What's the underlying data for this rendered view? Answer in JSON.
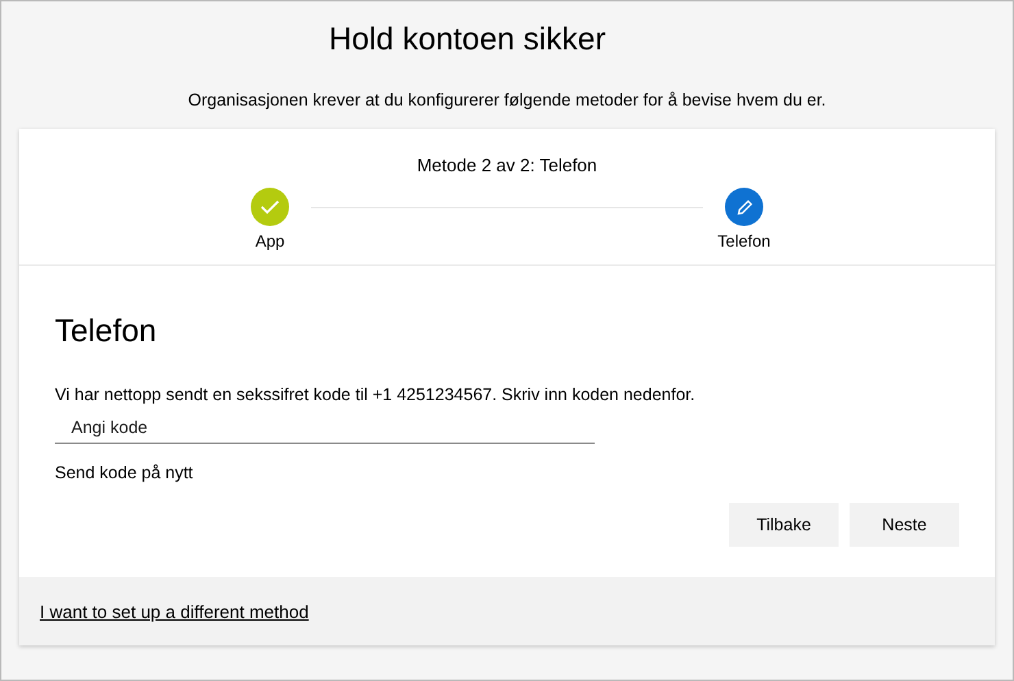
{
  "page": {
    "title": "Hold kontoen sikker",
    "subtitle": "Organisasjonen krever at du konfigurerer følgende metoder for å bevise hvem du er."
  },
  "progress": {
    "heading": "Metode 2 av 2: Telefon",
    "steps": [
      {
        "label": "App",
        "completed": true
      },
      {
        "label": "Telefon",
        "completed": false
      }
    ]
  },
  "section": {
    "title": "Telefon",
    "instruction": "Vi har nettopp sendt en sekssifret kode til +1 4251234567. Skriv inn koden nedenfor.",
    "code_field": {
      "placeholder": "Angi kode"
    },
    "resend_link": "Send kode på nytt"
  },
  "buttons": [
    {
      "label": "Tilbake"
    },
    {
      "label": "Neste"
    }
  ],
  "footer": {
    "link": "I want to set up a different method"
  }
}
